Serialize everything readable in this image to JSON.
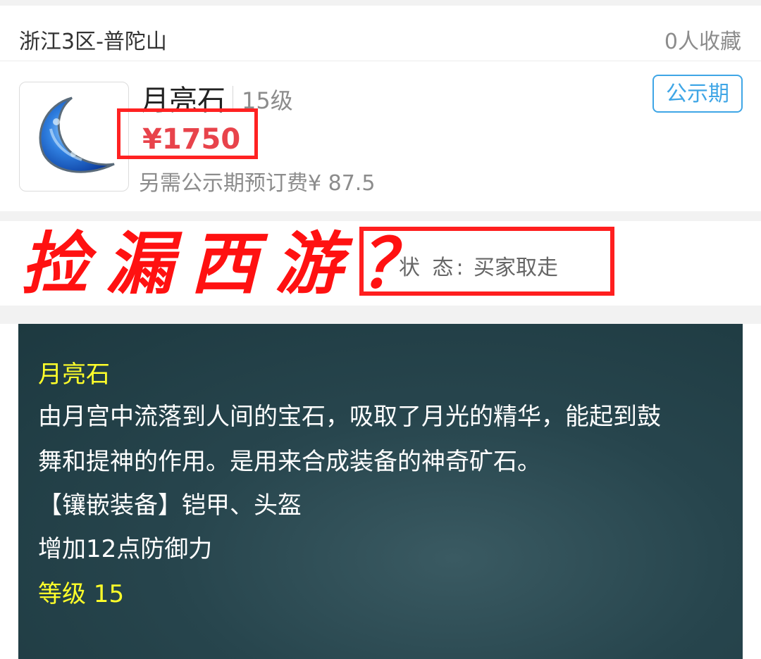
{
  "header": {
    "server": "浙江3区-普陀山",
    "favorites": "0人收藏"
  },
  "item": {
    "name": "月亮石",
    "level": "15级",
    "price": "¥1750",
    "deposit": "另需公示期预订费¥ 87.5",
    "badge": "公示期",
    "icon": "moon-stone-icon"
  },
  "overlay": {
    "title": "捡漏西游？"
  },
  "status": {
    "label": "状 态:",
    "value": "买家取走"
  },
  "description": {
    "title": "月亮石",
    "line1": "由月宫中流落到人间的宝石，吸取了月光的精华，能起到鼓",
    "line2": "舞和提神的作用。是用来合成装备的神奇矿石。",
    "line3": "【镶嵌装备】铠甲、头盔",
    "line4": "增加12点防御力",
    "level_line": "等级 15"
  },
  "colors": {
    "price": "#e8434b",
    "badge": "#3fa6e6",
    "annotation_red": "#ff1f1f",
    "panel_bg": "#27454d",
    "highlight_yellow": "#ffff2a"
  }
}
